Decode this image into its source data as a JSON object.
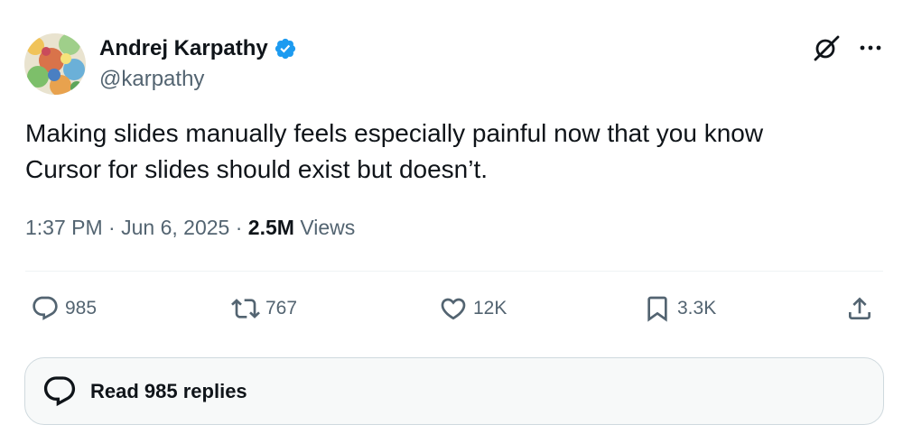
{
  "author": {
    "display_name": "Andrej Karpathy",
    "handle": "@karpathy",
    "verified": true,
    "verified_color": "#1d9bf0"
  },
  "tweet": {
    "text_line1": "Making slides manually feels especially painful now that you know",
    "text_line2": "Cursor for slides should exist but doesn’t."
  },
  "meta": {
    "time": "1:37 PM",
    "separator": "·",
    "date": "Jun 6, 2025",
    "views_count": "2.5M",
    "views_label": "Views"
  },
  "actions": {
    "replies": "985",
    "reposts": "767",
    "likes": "12K",
    "bookmarks": "3.3K"
  },
  "read_replies": {
    "label": "Read 985 replies"
  },
  "icons": {
    "verified": "verified-badge-icon",
    "grok": "grok-icon",
    "more": "more-options-icon",
    "reply": "reply-bubble-icon",
    "repost": "repost-icon",
    "like": "heart-icon",
    "bookmark": "bookmark-icon",
    "share": "share-upload-icon"
  }
}
